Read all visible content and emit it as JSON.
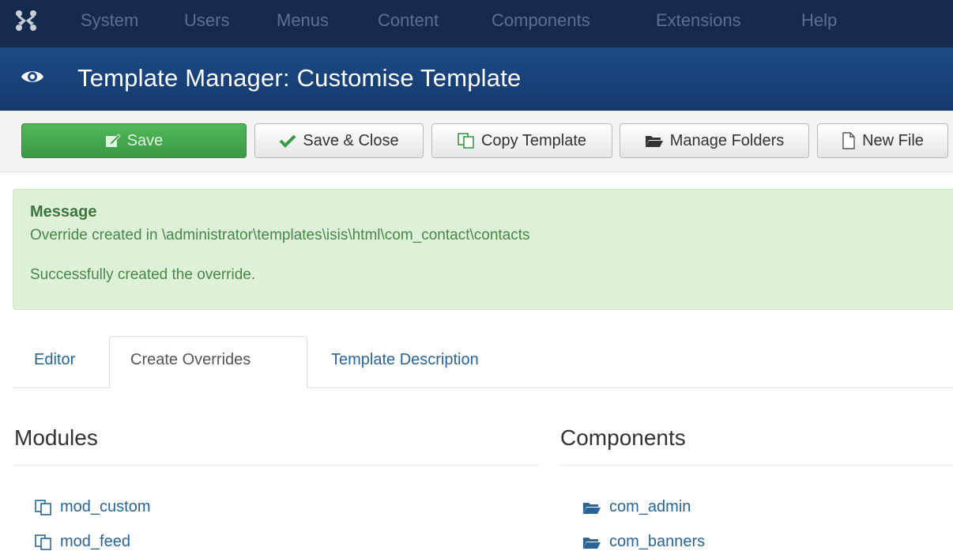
{
  "app": {
    "nav": {
      "items": [
        "System",
        "Users",
        "Menus",
        "Content",
        "Components",
        "Extensions",
        "Help"
      ]
    },
    "header": {
      "title": "Template Manager: Customise Template",
      "icon": "eye-icon"
    }
  },
  "toolbar": {
    "save_label": "Save",
    "save_close_label": "Save & Close",
    "copy_label": "Copy Template",
    "folders_label": "Manage Folders",
    "newfile_label": "New File"
  },
  "message": {
    "heading": "Message",
    "line1": "Override created in \\administrator\\templates\\isis\\html\\com_contact\\contacts",
    "line2": "Successfully created the override."
  },
  "tabs": {
    "editor": "Editor",
    "overrides": "Create Overrides",
    "description": "Template Description",
    "active": "Create Overrides"
  },
  "modules": {
    "title": "Modules",
    "items": [
      "mod_custom",
      "mod_feed"
    ]
  },
  "components": {
    "title": "Components",
    "items": [
      "com_admin",
      "com_banners"
    ]
  },
  "colors": {
    "topnav": "#152b4d",
    "header": "#1d4a86",
    "save": "#46a84f",
    "message_bg": "#dff0d8",
    "link": "#2a6496"
  }
}
